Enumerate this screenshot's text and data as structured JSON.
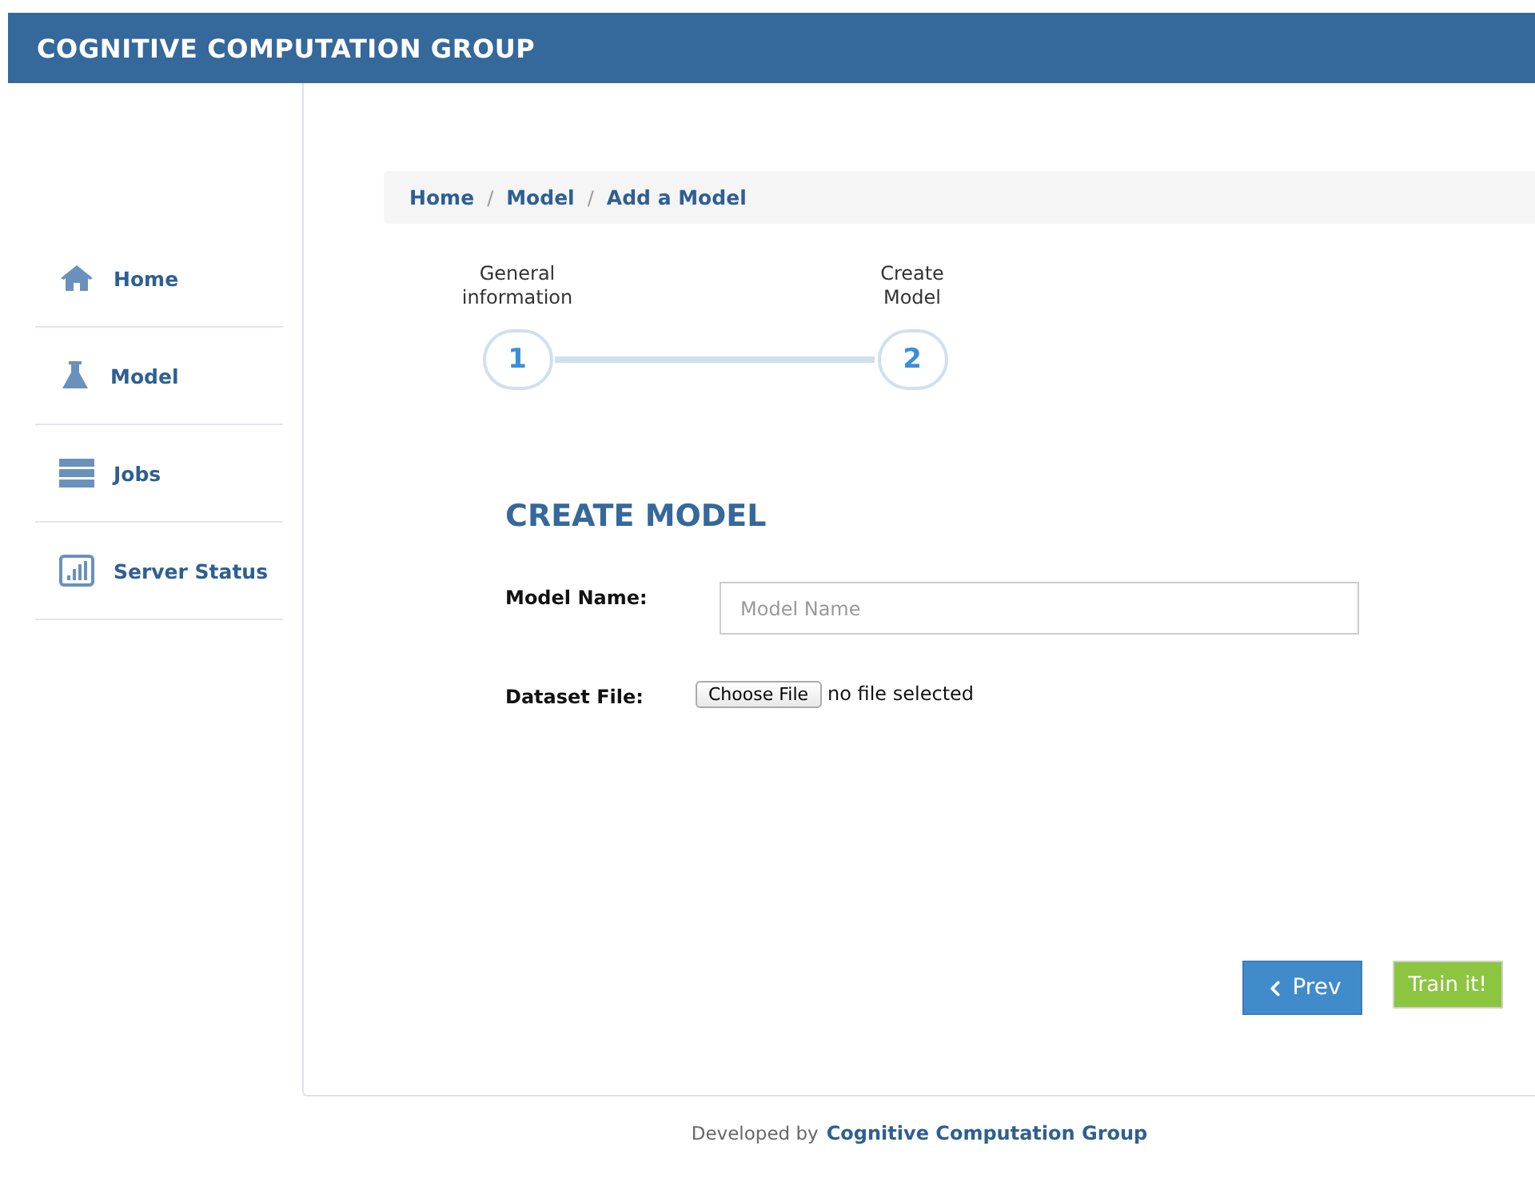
{
  "header": {
    "title": "COGNITIVE COMPUTATION GROUP"
  },
  "sidebar": {
    "items": [
      {
        "label": "Home"
      },
      {
        "label": "Model"
      },
      {
        "label": "Jobs"
      },
      {
        "label": "Server Status"
      }
    ]
  },
  "breadcrumb": {
    "items": [
      "Home",
      "Model",
      "Add a Model"
    ],
    "separators": [
      "/",
      "/"
    ]
  },
  "steps": [
    {
      "label": "General information",
      "number": "1"
    },
    {
      "label": "Create Model",
      "number": "2"
    }
  ],
  "form": {
    "title": "CREATE MODEL",
    "model_name": {
      "label": "Model Name:",
      "placeholder": "Model Name"
    },
    "dataset_file": {
      "label": "Dataset File:",
      "button": "Choose File",
      "status": "no file selected"
    }
  },
  "buttons": {
    "prev": "Prev",
    "train": "Train it!"
  },
  "footer": {
    "text": "Developed by",
    "link": "Cognitive Computation Group"
  }
}
